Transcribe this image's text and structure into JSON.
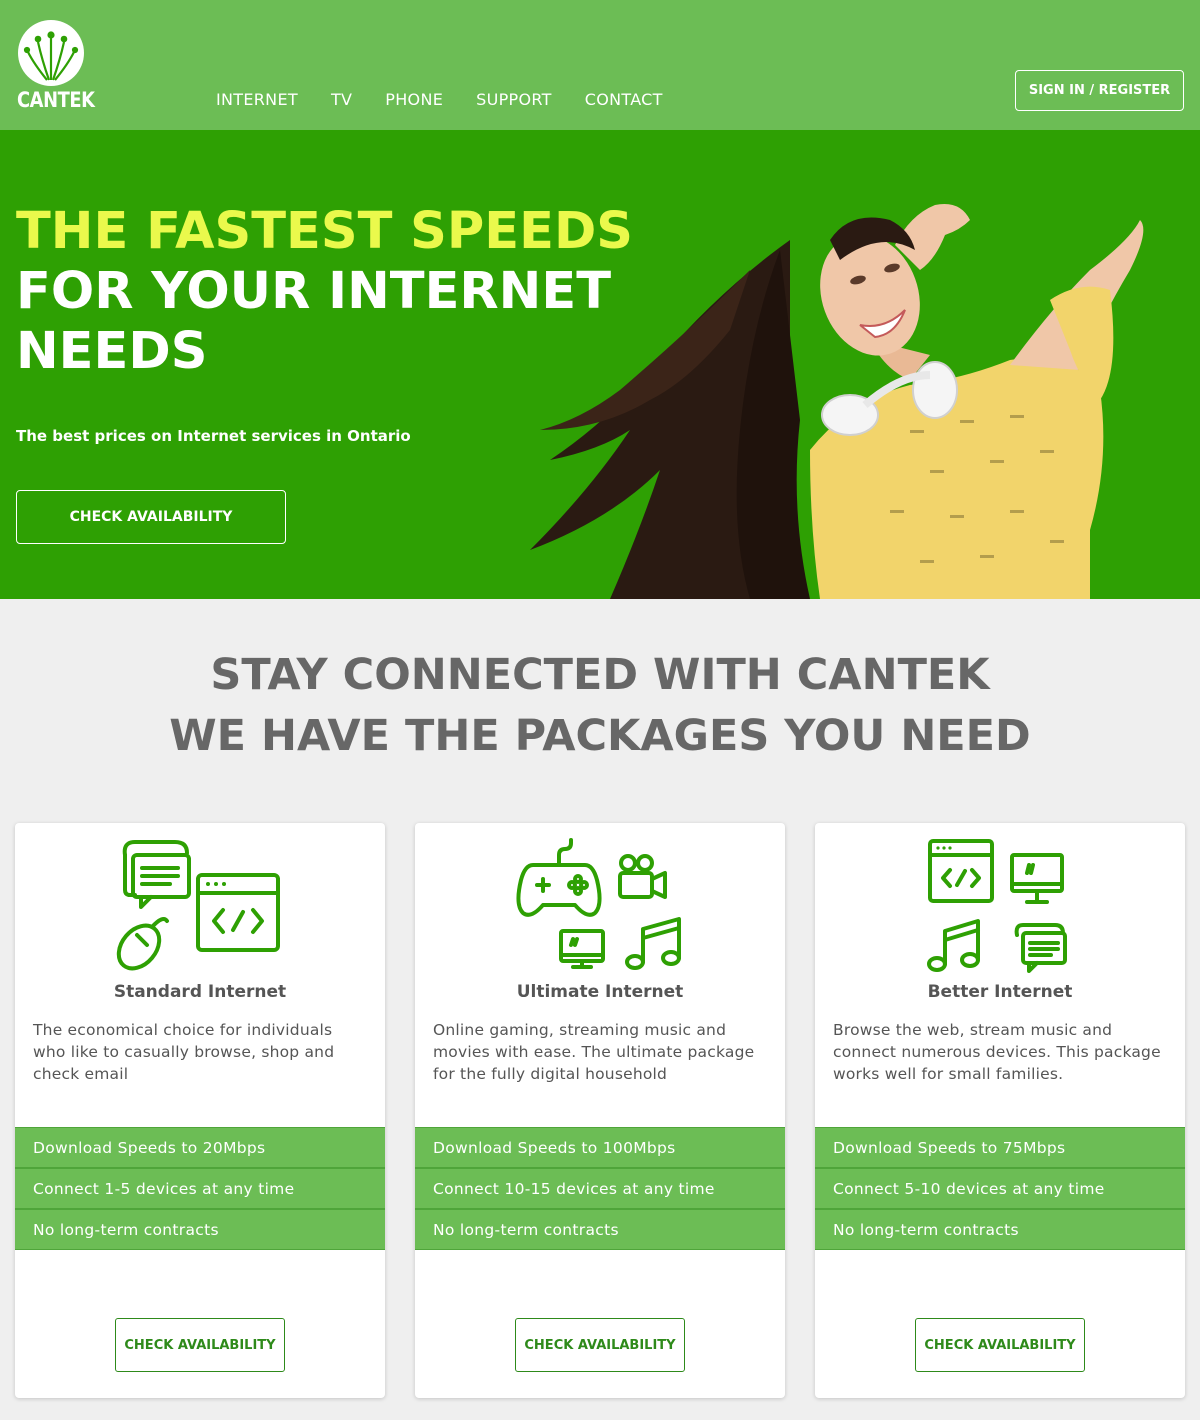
{
  "header": {
    "logo_text": "CANTEK",
    "nav": [
      "INTERNET",
      "TV",
      "PHONE",
      "SUPPORT",
      "CONTACT"
    ],
    "signin_label": "SIGN IN / REGISTER"
  },
  "hero": {
    "title_highlight": "THE FASTEST SPEEDS",
    "title_line2": "FOR YOUR INTERNET",
    "title_line3": "NEEDS",
    "subtitle": "The best prices on Internet services in Ontario",
    "button_label": "CHECK AVAILABILITY"
  },
  "section": {
    "line1": "STAY CONNECTED WITH CANTEK",
    "line2": "WE HAVE THE PACKAGES YOU NEED"
  },
  "cards": [
    {
      "title": "Standard Internet",
      "description": "The economical choice for individuals who like to casually browse, shop and check email",
      "features": [
        "Download Speeds to 20Mbps",
        "Connect 1-5 devices at any time",
        "No long-term contracts"
      ],
      "button_label": "CHECK AVAILABILITY",
      "icons": [
        "chat-icon",
        "code-window-icon",
        "mouse-icon"
      ]
    },
    {
      "title": "Ultimate Internet",
      "description": "Online gaming, streaming music and movies with ease. The ultimate package for the fully digital household",
      "features": [
        "Download Speeds to 100Mbps",
        "Connect 10-15 devices at any time",
        "No long-term contracts"
      ],
      "button_label": "CHECK AVAILABILITY",
      "icons": [
        "gamepad-icon",
        "video-camera-icon",
        "monitor-icon",
        "music-note-icon"
      ]
    },
    {
      "title": "Better Internet",
      "description": "Browse the web, stream music and connect numerous devices. This package works well for small families.",
      "features": [
        "Download Speeds to 75Mbps",
        "Connect 5-10 devices at any time",
        "No long-term contracts"
      ],
      "button_label": "CHECK AVAILABILITY",
      "icons": [
        "code-window-icon",
        "monitor-icon",
        "music-note-icon",
        "chat-icon"
      ]
    }
  ],
  "colors": {
    "header_green": "#6cbd55",
    "hero_green": "#2ea003",
    "highlight_yellow": "#eaf94c",
    "text_gray": "#676767"
  }
}
